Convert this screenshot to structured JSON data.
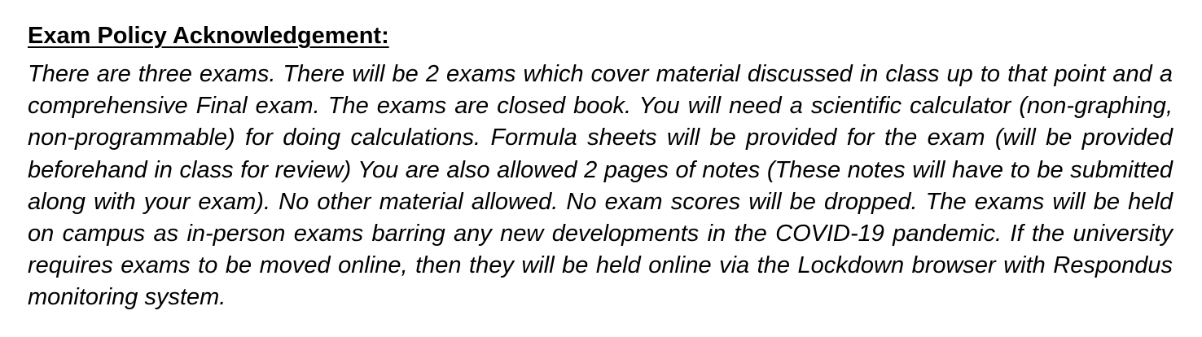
{
  "document": {
    "heading": "Exam Policy Acknowledgement:",
    "body": "There are three exams. There will be 2 exams which cover material discussed in class up to that point and a comprehensive Final exam. The exams are closed book. You will need a scientific calculator (non-graphing, non-programmable) for doing calculations. Formula sheets will be provided for the exam (will be provided beforehand in class for review) You are also allowed 2 pages of notes (These notes will have to be submitted along with your exam). No other material allowed. No exam scores will be dropped. The exams will be held on campus as in-person exams barring any new developments in the COVID-19 pandemic. If the university requires exams to be moved online, then they will be held online via the Lockdown browser with Respondus monitoring system."
  }
}
